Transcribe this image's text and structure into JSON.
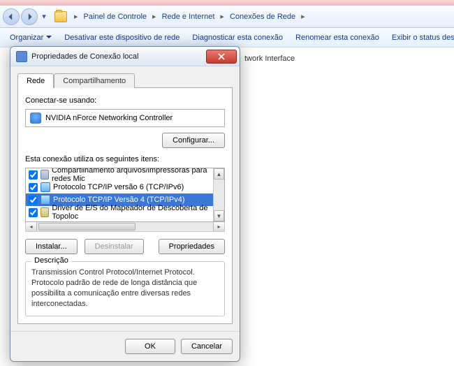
{
  "breadcrumb": {
    "a": "Painel de Controle",
    "b": "Rede e Internet",
    "c": "Conexões de Rede"
  },
  "cmdbar": {
    "organize": "Organizar",
    "disable": "Desativar este dispositivo de rede",
    "diagnose": "Diagnosticar esta conexão",
    "rename": "Renomear esta conexão",
    "status": "Exibir o status desta cone"
  },
  "background": {
    "item": "twork Interface"
  },
  "dialog": {
    "title": "Propriedades de Conexão local",
    "tabs": {
      "net": "Rede",
      "share": "Compartilhamento"
    },
    "connect_using": "Conectar-se usando:",
    "adapter": "NVIDIA nForce Networking Controller",
    "configure": "Configurar...",
    "uses_items": "Esta conexão utiliza os seguintes itens:",
    "items": [
      {
        "label": "Compartilhamento arquivos/impressoras para redes Mic",
        "icon": "printer",
        "checked": true
      },
      {
        "label": "Protocolo TCP/IP versão 6 (TCP/IPv6)",
        "icon": "proto",
        "checked": true
      },
      {
        "label": "Protocolo TCP/IP Versão 4 (TCP/IPv4)",
        "icon": "proto",
        "checked": true,
        "selected": true
      },
      {
        "label": "Driver de E/S do Mapeador de Descoberta de Topoloc",
        "icon": "driver",
        "checked": true
      }
    ],
    "install": "Instalar...",
    "uninstall": "Desinstalar",
    "properties": "Propriedades",
    "desc_legend": "Descrição",
    "desc_body": "Transmission Control Protocol/Internet Protocol. Protocolo padrão de rede de longa distância que possibilita a comunicação entre diversas redes interconectadas.",
    "ok": "OK",
    "cancel": "Cancelar"
  }
}
